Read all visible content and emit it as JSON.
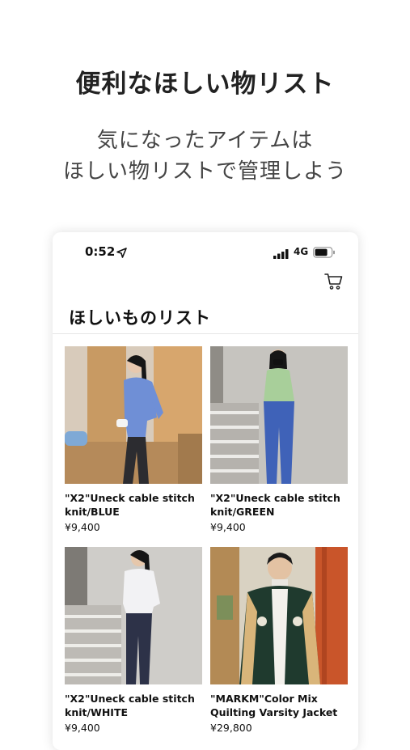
{
  "promo": {
    "headline": "便利なほしい物リスト",
    "subline_1": "気になったアイテムは",
    "subline_2": "ほしい物リストで管理しよう"
  },
  "status_bar": {
    "time": "0:52",
    "network": "4G",
    "icons": [
      "location-arrow-icon",
      "signal-bars-icon",
      "battery-icon"
    ]
  },
  "header": {
    "cart_icon": "cart-icon",
    "title": "ほしいものリスト"
  },
  "products": [
    {
      "name": "\"X2\"Uneck cable stitch knit/BLUE",
      "price": "¥9,400",
      "color": "#6f8fd6"
    },
    {
      "name": "\"X2\"Uneck cable stitch knit/GREEN",
      "price": "¥9,400",
      "color": "#a8cf9a"
    },
    {
      "name": "\"X2\"Uneck cable stitch knit/WHITE",
      "price": "¥9,400",
      "color": "#f2f2f4"
    },
    {
      "name": "\"MARKM\"Color Mix Quilting Varsity Jacket",
      "price": "¥29,800",
      "color": "#1f3a2e"
    }
  ]
}
